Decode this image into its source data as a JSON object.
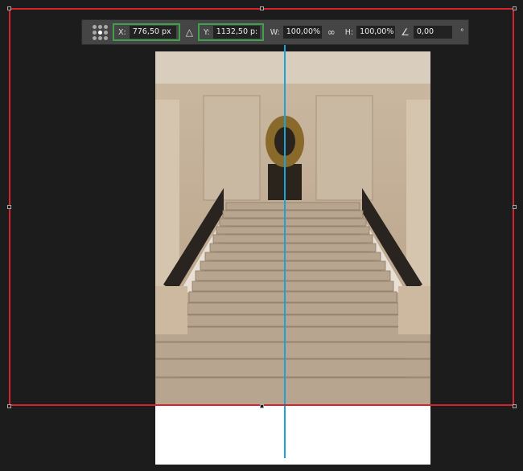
{
  "toolbar": {
    "x_label": "X:",
    "x_value": "776,50 px",
    "delta_icon": "delta-icon",
    "y_label": "Y:",
    "y_value": "1132,50 p:",
    "w_label": "W:",
    "w_value": "100,00%",
    "link_icon": "link-icon",
    "h_label": "H:",
    "h_value": "100,00%",
    "angle_icon": "angle-icon",
    "angle_value": "0,00",
    "degree": "°"
  },
  "colors": {
    "bounding_box": "#d4232a",
    "guide": "#1aa3d6",
    "highlight": "#3fa14a"
  }
}
